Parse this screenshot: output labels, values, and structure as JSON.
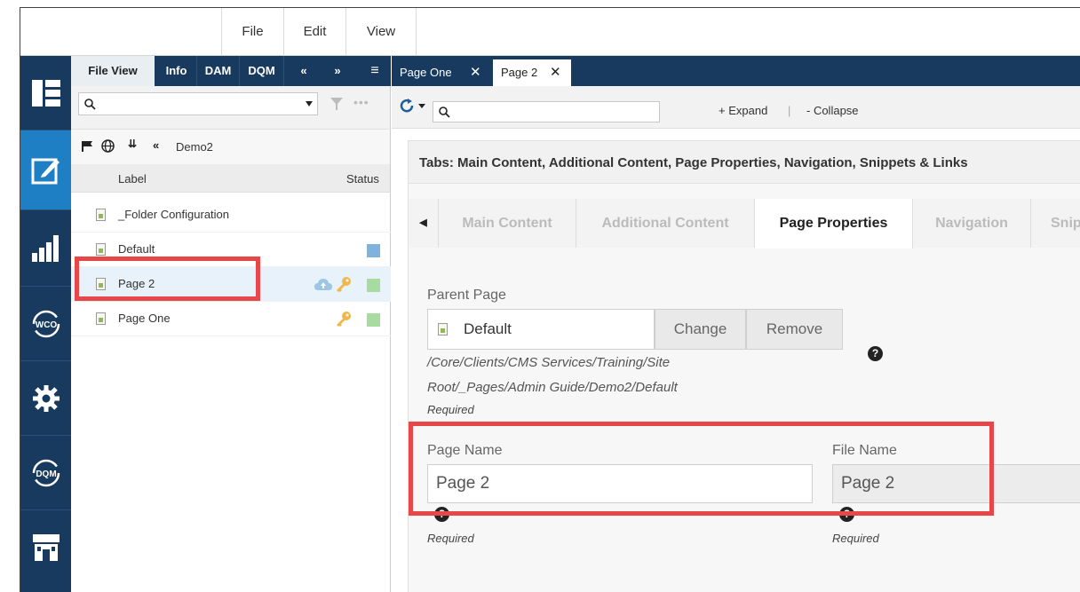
{
  "menu": {
    "file": "File",
    "edit": "Edit",
    "view": "View"
  },
  "file_view": {
    "tabs": [
      "File View",
      "Info",
      "DAM",
      "DQM"
    ],
    "nav_prev": "«",
    "nav_next": "»",
    "menu_icon": "≡",
    "search_placeholder": "",
    "folder_name": "Demo2",
    "columns": {
      "label": "Label",
      "status": "Status"
    },
    "rows": [
      {
        "label": "_Folder Configuration"
      },
      {
        "label": "Default"
      },
      {
        "label": "Page 2"
      },
      {
        "label": "Page One"
      }
    ]
  },
  "page_tabs": [
    {
      "label": "Page One"
    },
    {
      "label": "Page 2"
    }
  ],
  "toolbar": {
    "expand": "+ Expand",
    "separator": "|",
    "collapse": "- Collapse"
  },
  "content": {
    "tabs_heading": "Tabs: Main Content, Additional Content, Page Properties, Navigation, Snippets & Links",
    "content_tabs": [
      "Main Content",
      "Additional Content",
      "Page Properties",
      "Navigation",
      "Snip"
    ],
    "parent_page": {
      "label": "Parent Page",
      "value": "Default",
      "change": "Change",
      "remove": "Remove",
      "path_line1": "/Core/Clients/CMS Services/Training/Site",
      "path_line2": "Root/_Pages/Admin Guide/Demo2/Default",
      "required": "Required"
    },
    "page_name": {
      "label": "Page Name",
      "value": "Page 2",
      "required": "Required"
    },
    "file_name": {
      "label": "File Name",
      "value": "Page 2",
      "required": "Required"
    },
    "help_glyph": "?"
  },
  "colors": {
    "nav_dark": "#173a5e",
    "nav_active": "#1f7fc4",
    "highlight_red": "#e8474a",
    "status_blue": "#7fb2dd",
    "status_green": "#a8dba0"
  }
}
